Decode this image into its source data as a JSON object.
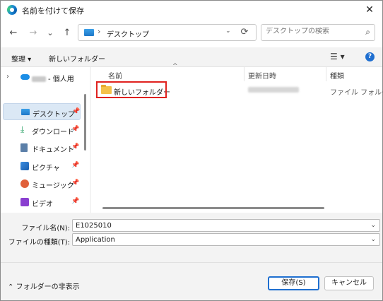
{
  "window": {
    "title": "名前を付けて保存"
  },
  "nav": {
    "back_icon": "←",
    "forward_icon": "→",
    "history_icon": "⌄",
    "up_icon": "↑",
    "address_path": "デスクトップ",
    "address_sep": "›",
    "search_placeholder": "デスクトップの検索"
  },
  "command_bar": {
    "organize_label": "整理 ▾",
    "new_folder_label": "新しいフォルダー"
  },
  "sidebar": {
    "items": [
      {
        "label": "- 個人用",
        "icon": "cloud-icon"
      },
      {
        "label": "デスクトップ",
        "icon": "desktop-icon",
        "pin": "📌"
      },
      {
        "label": "ダウンロード",
        "icon": "download-icon",
        "pin": "📌"
      },
      {
        "label": "ドキュメント",
        "icon": "document-icon",
        "pin": "📌"
      },
      {
        "label": "ピクチャ",
        "icon": "pictures-icon",
        "pin": "📌"
      },
      {
        "label": "ミュージック",
        "icon": "music-icon",
        "pin": "📌"
      },
      {
        "label": "ビデオ",
        "icon": "video-icon",
        "pin": "📌"
      }
    ]
  },
  "file_list": {
    "columns": [
      "名前",
      "更新日時",
      "種類"
    ],
    "rows": [
      {
        "name": "新しいフォルダー",
        "type": "ファイル フォルダー"
      }
    ]
  },
  "fields": {
    "filename_label": "ファイル名(N):",
    "filename_value": "E1025010",
    "filetype_label": "ファイルの種類(T):",
    "filetype_value": "Application"
  },
  "footer": {
    "hide_folders_label": "フォルダーの非表示",
    "save_label": "保存(S)",
    "cancel_label": "キャンセル"
  },
  "colors": {
    "accent": "#1f6fd0",
    "highlight": "#e0221f",
    "selected_bg": "#dbe8f5"
  }
}
